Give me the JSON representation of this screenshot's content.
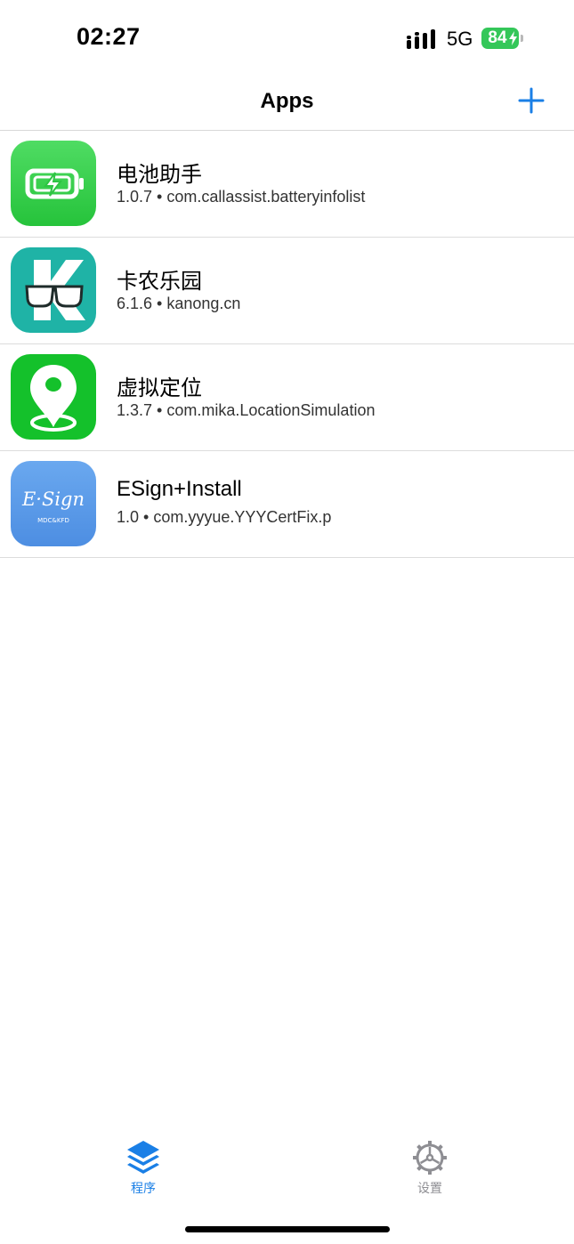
{
  "status_bar": {
    "time": "02:27",
    "network": "5G",
    "battery_level": "84",
    "battery_color": "#34c759",
    "icons": [
      "signal-icon",
      "battery-icon",
      "charging-bolt-icon"
    ]
  },
  "nav": {
    "title": "Apps",
    "add_icon": "plus-icon",
    "accent_color": "#1a7fe6"
  },
  "apps": [
    {
      "name": "电池助手",
      "version": "1.0.7",
      "bundle": "com.callassist.batteryinfolist",
      "icon": "battery-app-icon"
    },
    {
      "name": "卡农乐园",
      "version": "6.1.6",
      "bundle": "kanong.cn",
      "icon": "kanong-app-icon"
    },
    {
      "name": "虚拟定位",
      "version": "1.3.7",
      "bundle": "com.mika.LocationSimulation",
      "icon": "location-app-icon"
    },
    {
      "name": "ESign+Install",
      "version": "1.0",
      "bundle": "com.yyyue.YYYCertFix.p",
      "icon": "esign-app-icon",
      "icon_text": "E·Sign",
      "icon_subtext": "MDC&KFD"
    }
  ],
  "tabs": [
    {
      "label": "程序",
      "icon": "stack-layers-icon",
      "selected": true
    },
    {
      "label": "设置",
      "icon": "gear-icon",
      "selected": false
    }
  ]
}
